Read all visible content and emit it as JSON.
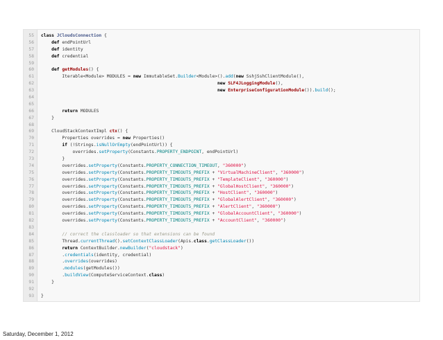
{
  "footer": {
    "date": "Saturday, December 1, 2012"
  },
  "colors": {
    "background": "#ffffff",
    "panel": "#f8f8f8",
    "gutter": "#ececec",
    "keyword": "#000000",
    "type": "#445588",
    "function": "#990000",
    "string": "#dd1144",
    "constant": "#008080",
    "method_call": "#0086b3",
    "comment": "#999988"
  },
  "code": {
    "lines": [
      {
        "num": "55",
        "tokens": [
          {
            "t": "class ",
            "k": "kw"
          },
          {
            "t": "JCloudsConnection",
            "k": "type"
          },
          {
            "t": " {",
            "k": "txt"
          }
        ]
      },
      {
        "num": "56",
        "tokens": [
          {
            "t": "    ",
            "k": "txt"
          },
          {
            "t": "def ",
            "k": "kw"
          },
          {
            "t": "endPointUrl",
            "k": "txt"
          }
        ]
      },
      {
        "num": "57",
        "tokens": [
          {
            "t": "    ",
            "k": "txt"
          },
          {
            "t": "def ",
            "k": "kw"
          },
          {
            "t": "identity",
            "k": "txt"
          }
        ]
      },
      {
        "num": "58",
        "tokens": [
          {
            "t": "    ",
            "k": "txt"
          },
          {
            "t": "def ",
            "k": "kw"
          },
          {
            "t": "credential",
            "k": "txt"
          }
        ]
      },
      {
        "num": "59",
        "tokens": []
      },
      {
        "num": "60",
        "tokens": [
          {
            "t": "    ",
            "k": "txt"
          },
          {
            "t": "def ",
            "k": "kw"
          },
          {
            "t": "getModules",
            "k": "fn"
          },
          {
            "t": "() {",
            "k": "txt"
          }
        ]
      },
      {
        "num": "61",
        "tokens": [
          {
            "t": "        Iterable<Module> MODULES = ",
            "k": "txt"
          },
          {
            "t": "new ",
            "k": "kw"
          },
          {
            "t": "ImmutableSet.",
            "k": "txt"
          },
          {
            "t": "Builder",
            "k": "call"
          },
          {
            "t": "<Module>().",
            "k": "txt"
          },
          {
            "t": "add",
            "k": "call"
          },
          {
            "t": "(",
            "k": "txt"
          },
          {
            "t": "new ",
            "k": "kw"
          },
          {
            "t": "SshjSshClientModule(),",
            "k": "txt"
          }
        ]
      },
      {
        "num": "62",
        "tokens": [
          {
            "t": "                                                                   ",
            "k": "txt"
          },
          {
            "t": "new ",
            "k": "kw"
          },
          {
            "t": "SLF4JLoggingModule",
            "k": "fn"
          },
          {
            "t": "(),",
            "k": "txt"
          }
        ]
      },
      {
        "num": "63",
        "tokens": [
          {
            "t": "                                                                   ",
            "k": "txt"
          },
          {
            "t": "new ",
            "k": "kw"
          },
          {
            "t": "EnterpriseConfigurationModule",
            "k": "fn"
          },
          {
            "t": "()).",
            "k": "txt"
          },
          {
            "t": "build",
            "k": "call"
          },
          {
            "t": "();",
            "k": "txt"
          }
        ]
      },
      {
        "num": "64",
        "tokens": []
      },
      {
        "num": "65",
        "tokens": []
      },
      {
        "num": "66",
        "tokens": [
          {
            "t": "        ",
            "k": "txt"
          },
          {
            "t": "return ",
            "k": "kw"
          },
          {
            "t": "MODULES",
            "k": "txt"
          }
        ]
      },
      {
        "num": "67",
        "tokens": [
          {
            "t": "    }",
            "k": "txt"
          }
        ]
      },
      {
        "num": "68",
        "tokens": []
      },
      {
        "num": "69",
        "tokens": [
          {
            "t": "    CloudStackContextImpl ",
            "k": "txt"
          },
          {
            "t": "ctx",
            "k": "fn"
          },
          {
            "t": "() {",
            "k": "txt"
          }
        ]
      },
      {
        "num": "70",
        "tokens": [
          {
            "t": "        Properties overrides = ",
            "k": "txt"
          },
          {
            "t": "new ",
            "k": "kw"
          },
          {
            "t": "Properties()",
            "k": "txt"
          }
        ]
      },
      {
        "num": "71",
        "tokens": [
          {
            "t": "        ",
            "k": "txt"
          },
          {
            "t": "if ",
            "k": "kw"
          },
          {
            "t": "(!Strings.",
            "k": "txt"
          },
          {
            "t": "isNullOrEmpty",
            "k": "call"
          },
          {
            "t": "(endPointUrl)) {",
            "k": "txt"
          }
        ]
      },
      {
        "num": "72",
        "tokens": [
          {
            "t": "            overrides.",
            "k": "txt"
          },
          {
            "t": "setProperty",
            "k": "call"
          },
          {
            "t": "(Constants.",
            "k": "txt"
          },
          {
            "t": "PROPERTY_ENDPOINT",
            "k": "const"
          },
          {
            "t": ", endPointUrl)",
            "k": "txt"
          }
        ]
      },
      {
        "num": "73",
        "tokens": [
          {
            "t": "        }",
            "k": "txt"
          }
        ]
      },
      {
        "num": "74",
        "tokens": [
          {
            "t": "        overrides.",
            "k": "txt"
          },
          {
            "t": "setProperty",
            "k": "call"
          },
          {
            "t": "(Constants.",
            "k": "txt"
          },
          {
            "t": "PROPERTY_CONNECTION_TIMEOUT",
            "k": "const"
          },
          {
            "t": ", ",
            "k": "txt"
          },
          {
            "t": "\"360000\"",
            "k": "str"
          },
          {
            "t": ")",
            "k": "txt"
          }
        ]
      },
      {
        "num": "75",
        "tokens": [
          {
            "t": "        overrides.",
            "k": "txt"
          },
          {
            "t": "setProperty",
            "k": "call"
          },
          {
            "t": "(Constants.",
            "k": "txt"
          },
          {
            "t": "PROPERTY_TIMEOUTS_PREFIX",
            "k": "const"
          },
          {
            "t": " + ",
            "k": "txt"
          },
          {
            "t": "\"VirtualMachineClient\"",
            "k": "str"
          },
          {
            "t": ", ",
            "k": "txt"
          },
          {
            "t": "\"360000\"",
            "k": "str"
          },
          {
            "t": ")",
            "k": "txt"
          }
        ]
      },
      {
        "num": "76",
        "tokens": [
          {
            "t": "        overrides.",
            "k": "txt"
          },
          {
            "t": "setProperty",
            "k": "call"
          },
          {
            "t": "(Constants.",
            "k": "txt"
          },
          {
            "t": "PROPERTY_TIMEOUTS_PREFIX",
            "k": "const"
          },
          {
            "t": " + ",
            "k": "txt"
          },
          {
            "t": "\"TemplateClient\"",
            "k": "str"
          },
          {
            "t": ", ",
            "k": "txt"
          },
          {
            "t": "\"360000\"",
            "k": "str"
          },
          {
            "t": ")",
            "k": "txt"
          }
        ]
      },
      {
        "num": "77",
        "tokens": [
          {
            "t": "        overrides.",
            "k": "txt"
          },
          {
            "t": "setProperty",
            "k": "call"
          },
          {
            "t": "(Constants.",
            "k": "txt"
          },
          {
            "t": "PROPERTY_TIMEOUTS_PREFIX",
            "k": "const"
          },
          {
            "t": " + ",
            "k": "txt"
          },
          {
            "t": "\"GlobalHostClient\"",
            "k": "str"
          },
          {
            "t": ", ",
            "k": "txt"
          },
          {
            "t": "\"360000\"",
            "k": "str"
          },
          {
            "t": ")",
            "k": "txt"
          }
        ]
      },
      {
        "num": "78",
        "tokens": [
          {
            "t": "        overrides.",
            "k": "txt"
          },
          {
            "t": "setProperty",
            "k": "call"
          },
          {
            "t": "(Constants.",
            "k": "txt"
          },
          {
            "t": "PROPERTY_TIMEOUTS_PREFIX",
            "k": "const"
          },
          {
            "t": " + ",
            "k": "txt"
          },
          {
            "t": "\"HostClient\"",
            "k": "str"
          },
          {
            "t": ", ",
            "k": "txt"
          },
          {
            "t": "\"360000\"",
            "k": "str"
          },
          {
            "t": ")",
            "k": "txt"
          }
        ]
      },
      {
        "num": "79",
        "tokens": [
          {
            "t": "        overrides.",
            "k": "txt"
          },
          {
            "t": "setProperty",
            "k": "call"
          },
          {
            "t": "(Constants.",
            "k": "txt"
          },
          {
            "t": "PROPERTY_TIMEOUTS_PREFIX",
            "k": "const"
          },
          {
            "t": " + ",
            "k": "txt"
          },
          {
            "t": "\"GlobalAlertClient\"",
            "k": "str"
          },
          {
            "t": ", ",
            "k": "txt"
          },
          {
            "t": "\"360000\"",
            "k": "str"
          },
          {
            "t": ")",
            "k": "txt"
          }
        ]
      },
      {
        "num": "80",
        "tokens": [
          {
            "t": "        overrides.",
            "k": "txt"
          },
          {
            "t": "setProperty",
            "k": "call"
          },
          {
            "t": "(Constants.",
            "k": "txt"
          },
          {
            "t": "PROPERTY_TIMEOUTS_PREFIX",
            "k": "const"
          },
          {
            "t": " + ",
            "k": "txt"
          },
          {
            "t": "\"AlertClient\"",
            "k": "str"
          },
          {
            "t": ", ",
            "k": "txt"
          },
          {
            "t": "\"360000\"",
            "k": "str"
          },
          {
            "t": ")",
            "k": "txt"
          }
        ]
      },
      {
        "num": "81",
        "tokens": [
          {
            "t": "        overrides.",
            "k": "txt"
          },
          {
            "t": "setProperty",
            "k": "call"
          },
          {
            "t": "(Constants.",
            "k": "txt"
          },
          {
            "t": "PROPERTY_TIMEOUTS_PREFIX",
            "k": "const"
          },
          {
            "t": " + ",
            "k": "txt"
          },
          {
            "t": "\"GlobalAccountClient\"",
            "k": "str"
          },
          {
            "t": ", ",
            "k": "txt"
          },
          {
            "t": "\"360000\"",
            "k": "str"
          },
          {
            "t": ")",
            "k": "txt"
          }
        ]
      },
      {
        "num": "82",
        "tokens": [
          {
            "t": "        overrides.",
            "k": "txt"
          },
          {
            "t": "setProperty",
            "k": "call"
          },
          {
            "t": "(Constants.",
            "k": "txt"
          },
          {
            "t": "PROPERTY_TIMEOUTS_PREFIX",
            "k": "const"
          },
          {
            "t": " + ",
            "k": "txt"
          },
          {
            "t": "\"AccountClient\"",
            "k": "str"
          },
          {
            "t": ", ",
            "k": "txt"
          },
          {
            "t": "\"360000\"",
            "k": "str"
          },
          {
            "t": ")",
            "k": "txt"
          }
        ]
      },
      {
        "num": "83",
        "tokens": []
      },
      {
        "num": "84",
        "tokens": [
          {
            "t": "        // correct the classloader so that extensions can be found",
            "k": "cmt"
          }
        ]
      },
      {
        "num": "85",
        "tokens": [
          {
            "t": "        Thread.",
            "k": "txt"
          },
          {
            "t": "currentThread",
            "k": "call"
          },
          {
            "t": "().",
            "k": "txt"
          },
          {
            "t": "setContextClassLoader",
            "k": "call"
          },
          {
            "t": "(Apis.",
            "k": "txt"
          },
          {
            "t": "class",
            "k": "kw"
          },
          {
            "t": ".",
            "k": "txt"
          },
          {
            "t": "getClassLoader",
            "k": "call"
          },
          {
            "t": "())",
            "k": "txt"
          }
        ]
      },
      {
        "num": "86",
        "tokens": [
          {
            "t": "        ",
            "k": "txt"
          },
          {
            "t": "return ",
            "k": "kw"
          },
          {
            "t": "ContextBuilder.",
            "k": "txt"
          },
          {
            "t": "newBuilder",
            "k": "call"
          },
          {
            "t": "(",
            "k": "txt"
          },
          {
            "t": "\"cloudstack\"",
            "k": "str"
          },
          {
            "t": ")",
            "k": "txt"
          }
        ]
      },
      {
        "num": "87",
        "tokens": [
          {
            "t": "        .",
            "k": "txt"
          },
          {
            "t": "credentials",
            "k": "call"
          },
          {
            "t": "(identity, credential)",
            "k": "txt"
          }
        ]
      },
      {
        "num": "88",
        "tokens": [
          {
            "t": "        .",
            "k": "txt"
          },
          {
            "t": "overrides",
            "k": "call"
          },
          {
            "t": "(overrides)",
            "k": "txt"
          }
        ]
      },
      {
        "num": "89",
        "tokens": [
          {
            "t": "        .",
            "k": "txt"
          },
          {
            "t": "modules",
            "k": "call"
          },
          {
            "t": "(getModules())",
            "k": "txt"
          }
        ]
      },
      {
        "num": "90",
        "tokens": [
          {
            "t": "        .",
            "k": "txt"
          },
          {
            "t": "buildView",
            "k": "call"
          },
          {
            "t": "(ComputeServiceContext.",
            "k": "txt"
          },
          {
            "t": "class",
            "k": "kw"
          },
          {
            "t": ")",
            "k": "txt"
          }
        ]
      },
      {
        "num": "91",
        "tokens": [
          {
            "t": "    }",
            "k": "txt"
          }
        ]
      },
      {
        "num": "92",
        "tokens": []
      },
      {
        "num": "93",
        "tokens": [
          {
            "t": "}",
            "k": "txt"
          }
        ]
      }
    ]
  }
}
